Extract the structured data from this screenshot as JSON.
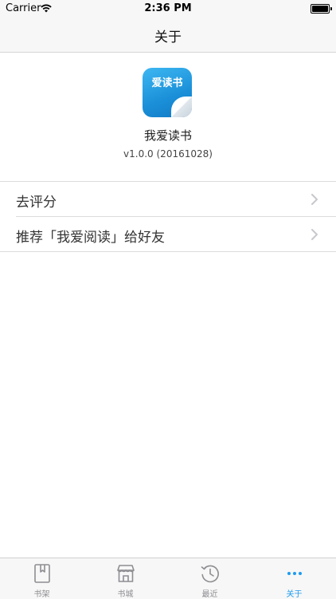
{
  "status_bar": {
    "carrier": "Carrier",
    "time": "2:36 PM"
  },
  "nav": {
    "title": "关于"
  },
  "app": {
    "icon_text": "爱读书",
    "name": "我爱读书",
    "version": "v1.0.0 (20161028)"
  },
  "menu": {
    "items": [
      {
        "label": "去评分",
        "icon": "chevron-right-icon"
      },
      {
        "label": "推荐「我爱阅读」给好友",
        "icon": "chevron-right-icon"
      }
    ]
  },
  "tab_bar": {
    "active": "关于",
    "active_color": "#1d9bf0",
    "inactive_color": "#8e8e93",
    "tabs": [
      {
        "label": "书架",
        "icon": "bookshelf-icon"
      },
      {
        "label": "书城",
        "icon": "store-icon"
      },
      {
        "label": "最近",
        "icon": "clock-icon"
      },
      {
        "label": "关于",
        "icon": "more-icon"
      }
    ]
  }
}
